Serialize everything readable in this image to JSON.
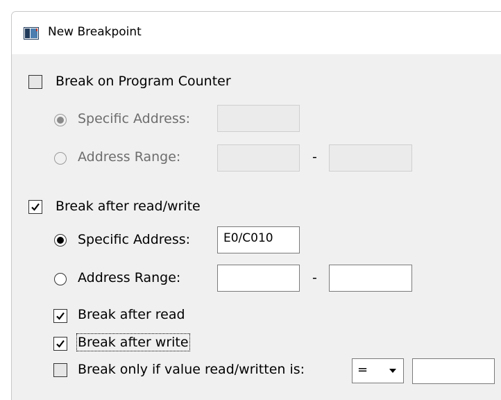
{
  "window": {
    "title": "New Breakpoint",
    "icon": "app-window-icon"
  },
  "pc_group": {
    "checkbox_label": "Break on Program Counter",
    "checked": false,
    "specific_label": "Specific Address:",
    "range_label": "Address Range:",
    "specific_value": "",
    "range_start": "",
    "range_end": "",
    "range_separator": "-"
  },
  "rw_group": {
    "checkbox_label": "Break after read/write",
    "checked": true,
    "specific_label": "Specific Address:",
    "specific_value": "E0/C010",
    "range_label": "Address Range:",
    "range_start": "",
    "range_end": "",
    "range_separator": "-",
    "break_read_label": "Break after read",
    "break_write_label": "Break after write",
    "break_value_label": "Break only if value read/written is:",
    "operator": "=",
    "compare_value": ""
  }
}
